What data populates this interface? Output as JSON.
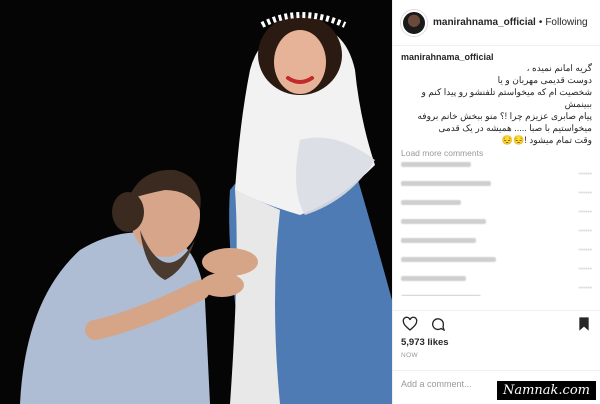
{
  "post": {
    "username": "manirahnama_official",
    "dot": "•",
    "follow_label": "Following"
  },
  "caption": {
    "username": "manirahnama_official",
    "lines": "گریه امانم نمیده ،\nدوست قدیمی مهربان و یا\nشخصیت ام که میخواستم تلفنشو رو پیدا کنم و\nببینمش\nپیام صابری عزیزم چرا !؟ منو ببخش خانم بروفه\nمیخواستیم با صبا ..... همیشه در یک قدمی\nوقت تمام میشود !😔😔"
  },
  "comments": {
    "load_more": "Load more comments",
    "items": [
      {
        "text": "......"
      },
      {
        "text": "......"
      },
      {
        "text": "......"
      },
      {
        "text": "......"
      },
      {
        "text": "......"
      },
      {
        "text": "......"
      },
      {
        "text": "......"
      },
      {
        "text": "......"
      }
    ]
  },
  "actions": {
    "like_icon": "heart-icon",
    "comment_icon": "comment-icon",
    "bookmark_icon": "bookmark-icon"
  },
  "likes": "5,973 likes",
  "time": "NOW",
  "add_comment_placeholder": "Add a comment...",
  "watermark": "Namnak.com"
}
